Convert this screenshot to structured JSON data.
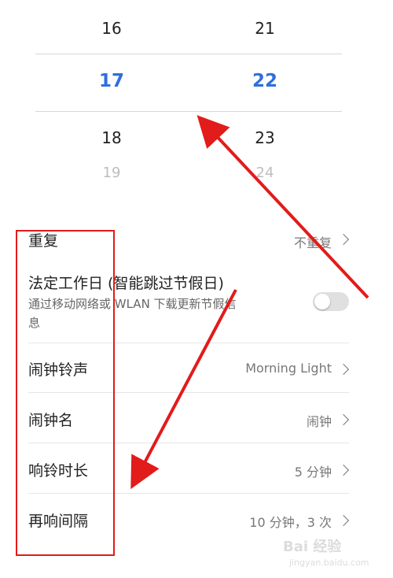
{
  "picker": {
    "hours": [
      "16",
      "17",
      "18",
      "19"
    ],
    "minutes": [
      "21",
      "22",
      "23",
      "24"
    ],
    "selected_color": "#2f6fdc"
  },
  "settings": {
    "repeat": {
      "label": "重复",
      "value": "不重复"
    },
    "holiday": {
      "label": "法定工作日 (智能跳过节假日)",
      "sub_line1": "通过移动网络或 WLAN 下载更新节假信",
      "sub_line2": "息",
      "toggle_on": false
    },
    "ringtone": {
      "label": "闹钟铃声",
      "value": "Morning Light"
    },
    "name": {
      "label": "闹钟名",
      "value": "闹钟"
    },
    "duration": {
      "label": "响铃时长",
      "value": "5 分钟"
    },
    "snooze": {
      "label": "再响间隔",
      "value": "10 分钟，3 次"
    }
  },
  "watermark": {
    "main": "Bai 经验",
    "sub": "jingyan.baidu.com"
  },
  "annotation_color": "#e21b1b"
}
